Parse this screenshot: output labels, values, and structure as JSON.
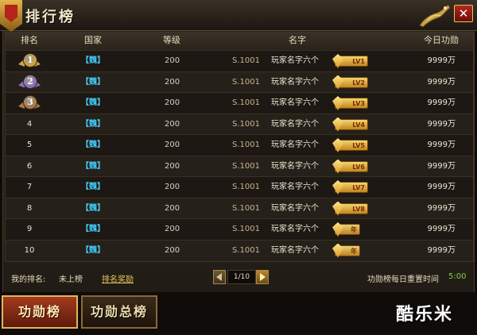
{
  "window": {
    "title": "排行榜",
    "close_label": "✕"
  },
  "table": {
    "headers": {
      "rank": "排名",
      "nation": "国家",
      "level": "等级",
      "name": "名字",
      "merit": "今日功勋"
    },
    "rows": [
      {
        "rank": "1",
        "nation": "【魏】",
        "level": "200",
        "server": "S.1001",
        "name": "玩家名字六个",
        "badge": "LV1",
        "merit": "9999万"
      },
      {
        "rank": "2",
        "nation": "【魏】",
        "level": "200",
        "server": "S.1001",
        "name": "玩家名字六个",
        "badge": "LV2",
        "merit": "9999万"
      },
      {
        "rank": "3",
        "nation": "【魏】",
        "level": "200",
        "server": "S.1001",
        "name": "玩家名字六个",
        "badge": "LV3",
        "merit": "9999万"
      },
      {
        "rank": "4",
        "nation": "【魏】",
        "level": "200",
        "server": "S.1001",
        "name": "玩家名字六个",
        "badge": "LV4",
        "merit": "9999万"
      },
      {
        "rank": "5",
        "nation": "【魏】",
        "level": "200",
        "server": "S.1001",
        "name": "玩家名字六个",
        "badge": "LV5",
        "merit": "9999万"
      },
      {
        "rank": "6",
        "nation": "【魏】",
        "level": "200",
        "server": "S.1001",
        "name": "玩家名字六个",
        "badge": "LV6",
        "merit": "9999万"
      },
      {
        "rank": "7",
        "nation": "【魏】",
        "level": "200",
        "server": "S.1001",
        "name": "玩家名字六个",
        "badge": "LV7",
        "merit": "9999万"
      },
      {
        "rank": "8",
        "nation": "【魏】",
        "level": "200",
        "server": "S.1001",
        "name": "玩家名字六个",
        "badge": "LV8",
        "merit": "9999万"
      },
      {
        "rank": "9",
        "nation": "【魏】",
        "level": "200",
        "server": "S.1001",
        "name": "玩家名字六个",
        "badge": "年",
        "merit": "9999万"
      },
      {
        "rank": "10",
        "nation": "【魏】",
        "level": "200",
        "server": "S.1001",
        "name": "玩家名字六个",
        "badge": "年",
        "merit": "9999万"
      }
    ]
  },
  "footer": {
    "my_rank_label": "我的排名:",
    "my_rank_value": "未上榜",
    "reward_link": "排名奖励",
    "page": "1/10",
    "reset_label": "功勋榜每日重置时间",
    "reset_time": "5:00"
  },
  "tabs": {
    "merit": "功勋榜",
    "total": "功勋总榜"
  },
  "watermark": "酷乐米",
  "colors": {
    "nation": "#42c8f2",
    "gold": "#e9c65a",
    "reset_time": "#7ed14a",
    "medal_1": "#c9a24a",
    "medal_2": "#8b6fb8",
    "medal_3": "#a87b4a"
  },
  "icons": {
    "close": "close-icon",
    "prev": "arrow-left-icon",
    "next": "arrow-right-icon",
    "medal": "rank-medal-icon",
    "badge": "vip-gem-icon"
  }
}
